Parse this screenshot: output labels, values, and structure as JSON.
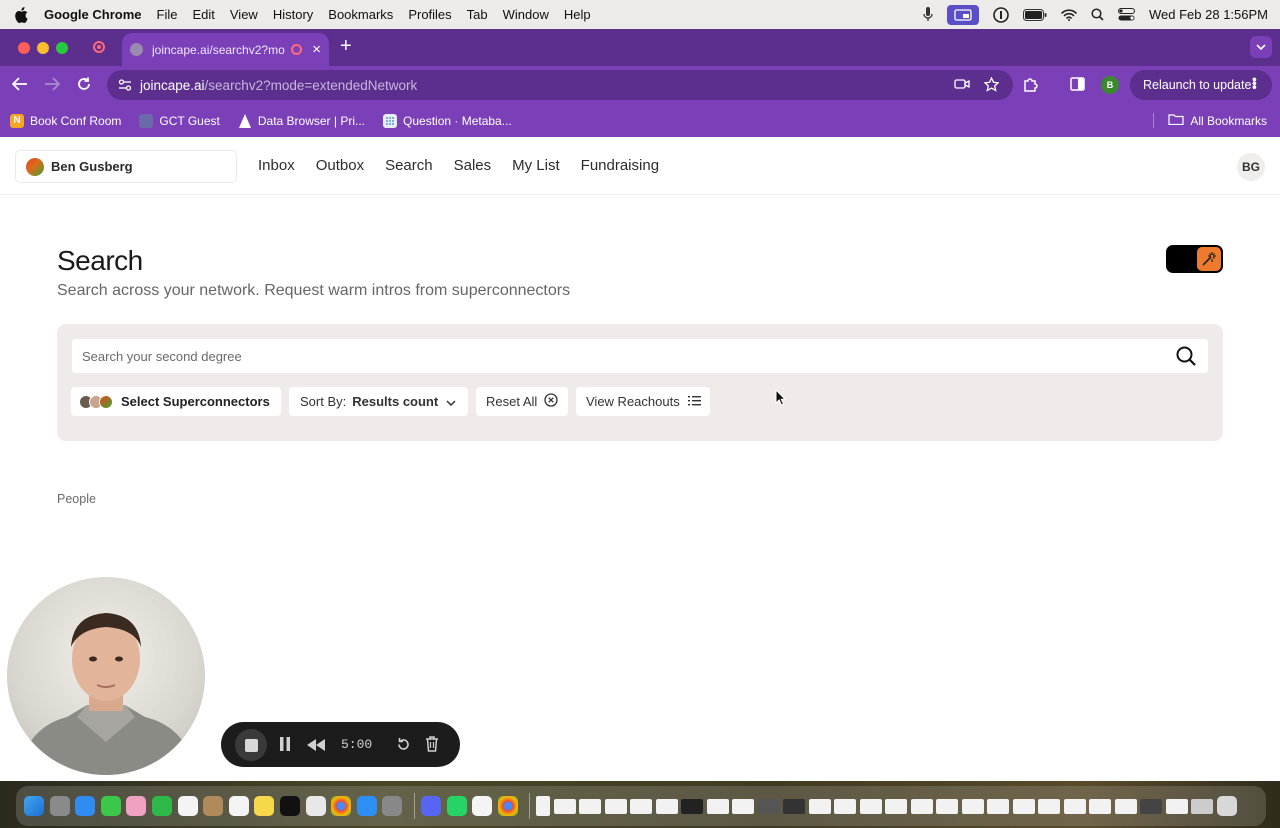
{
  "menubar": {
    "app_name": "Google Chrome",
    "items": [
      "File",
      "Edit",
      "View",
      "History",
      "Bookmarks",
      "Profiles",
      "Tab",
      "Window",
      "Help"
    ],
    "clock": "Wed Feb 28  1:56PM"
  },
  "browser": {
    "tab_title": "joincape.ai/searchv2?mod",
    "url_domain": "joincape.ai",
    "url_path": "/searchv2?mode=extendedNetwork",
    "profile_initial": "B",
    "relaunch_label": "Relaunch to update",
    "bookmarks": [
      {
        "label": "Book Conf Room",
        "icon_color": "#f5a623",
        "icon_text": "N"
      },
      {
        "label": "GCT Guest",
        "icon_color": "#6a6aa8",
        "icon_text": ""
      },
      {
        "label": "Data Browser | Pri...",
        "icon_color": "#ffffff",
        "icon_text": ""
      },
      {
        "label": "Question · Metaba...",
        "icon_color": "#e8eef7",
        "icon_text": ""
      }
    ],
    "all_bookmarks_label": "All Bookmarks",
    "accent_color": "#7b3fb8"
  },
  "app": {
    "user_name": "Ben Gusberg",
    "nav": [
      "Inbox",
      "Outbox",
      "Search",
      "Sales",
      "My List",
      "Fundraising"
    ],
    "user_initials": "BG"
  },
  "search_page": {
    "title": "Search",
    "subtitle": "Search across your network. Request warm intros from superconnectors",
    "input_placeholder": "Search your second degree",
    "select_superconnectors_label": "Select Superconnectors",
    "sort_label": "Sort By:",
    "sort_value": "Results count",
    "reset_label": "Reset All",
    "view_reachouts_label": "View Reachouts",
    "people_label": "People"
  },
  "recorder": {
    "time": "5:00"
  }
}
